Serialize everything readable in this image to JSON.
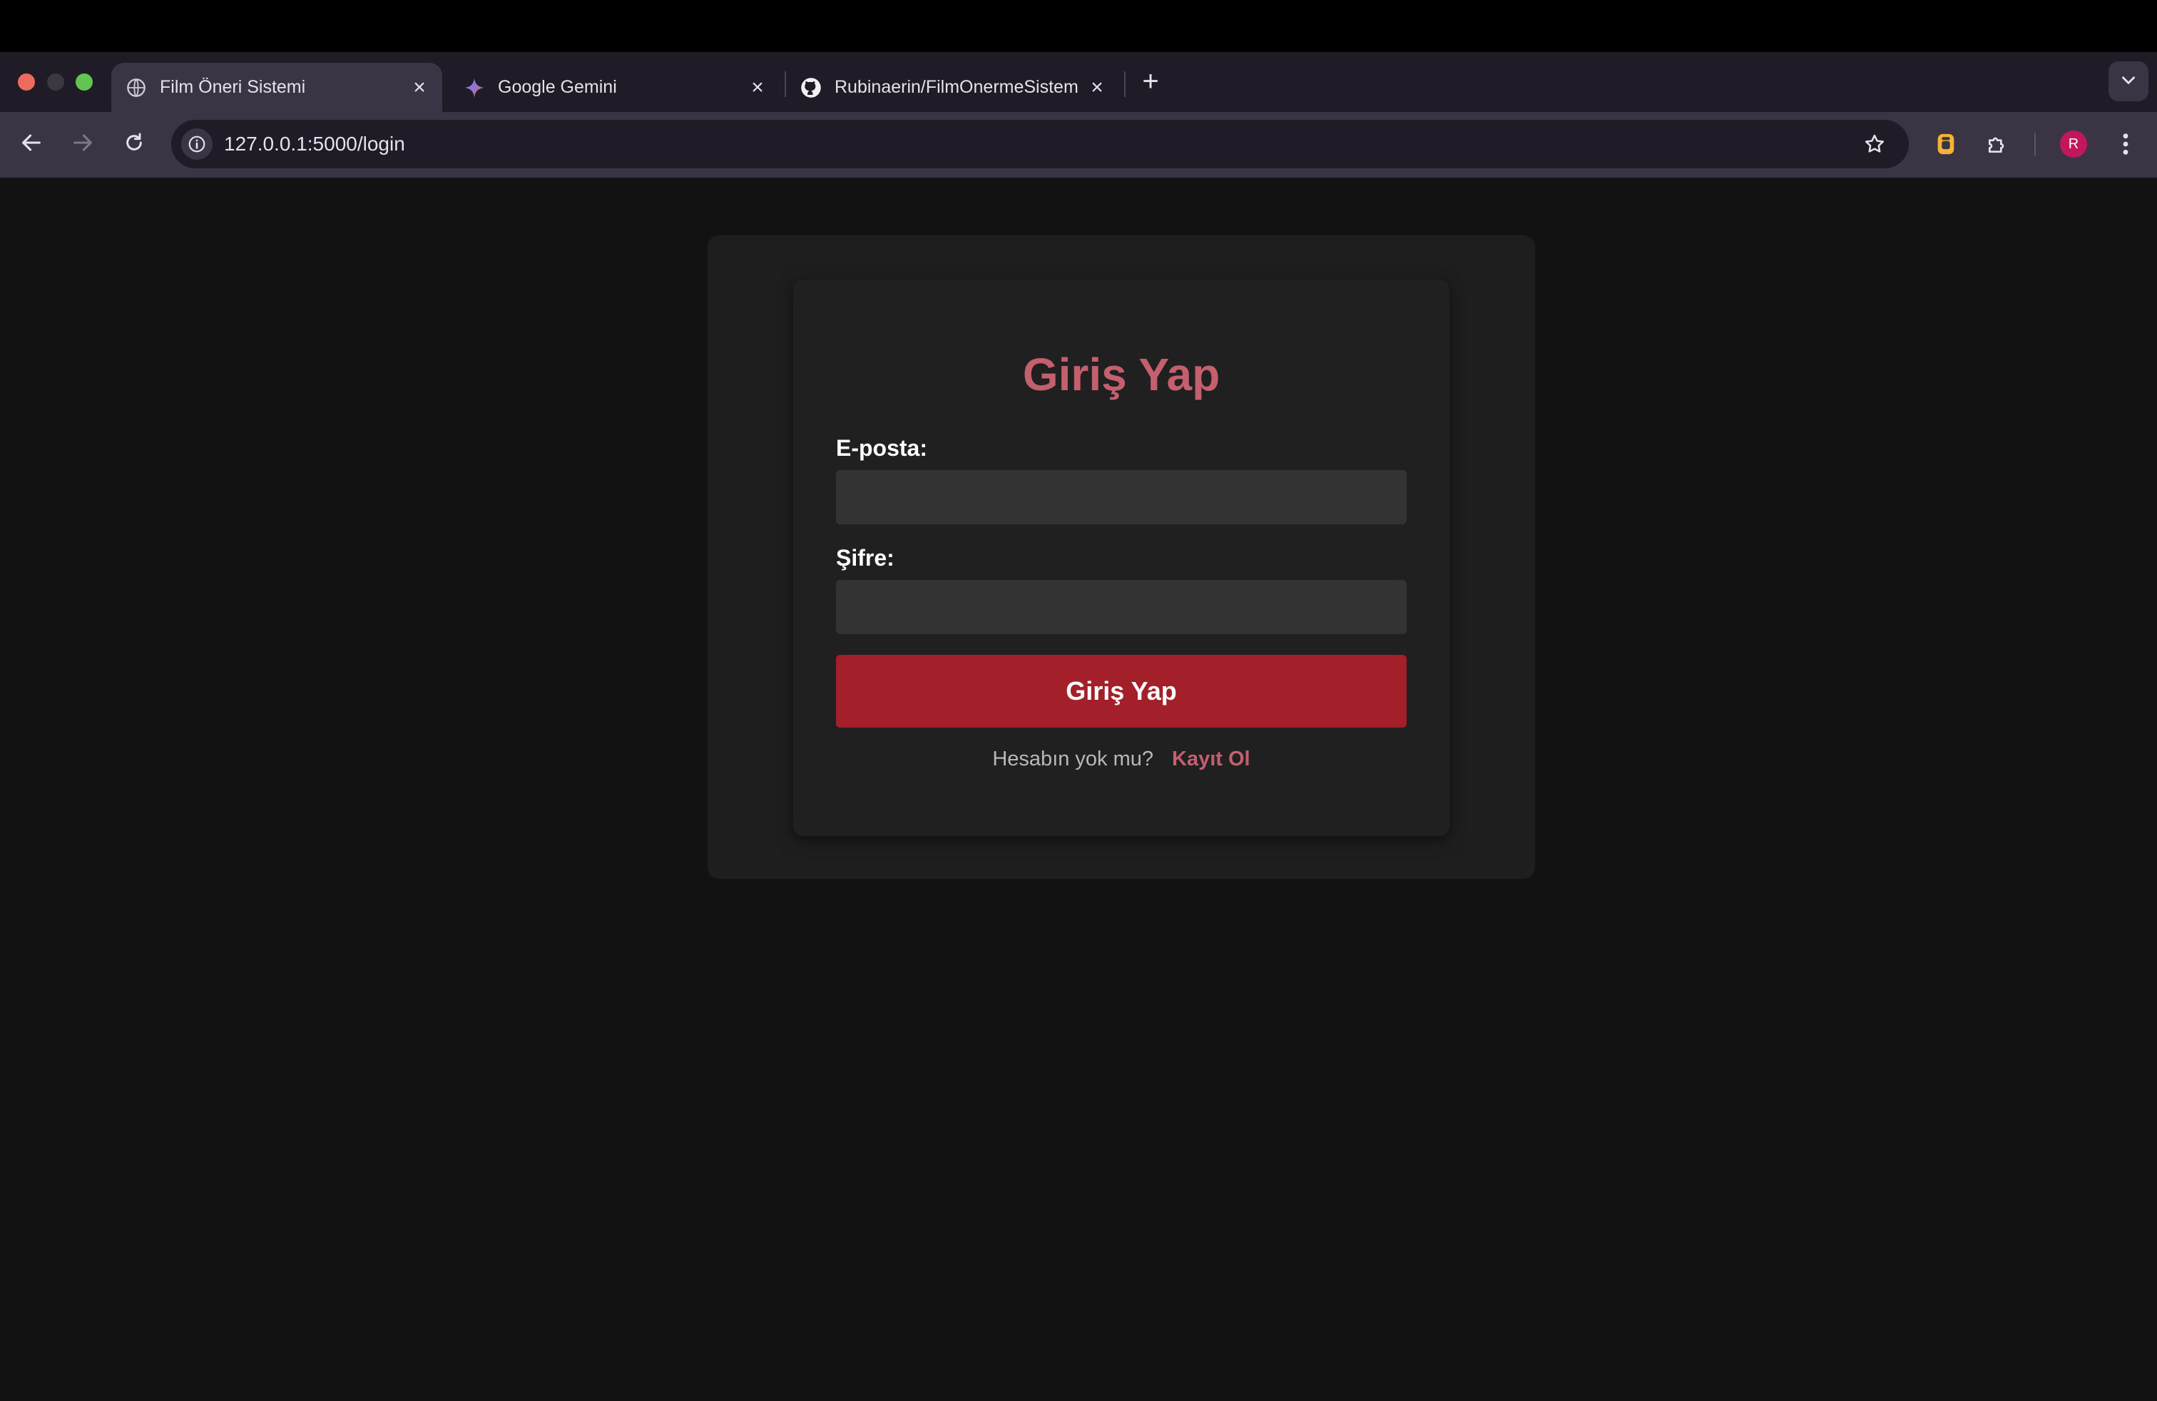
{
  "browser": {
    "tabs": [
      {
        "title": "Film Öneri Sistemi",
        "icon": "globe-icon",
        "active": true
      },
      {
        "title": "Google Gemini",
        "icon": "gemini-icon",
        "active": false
      },
      {
        "title": "Rubinaerin/FilmOnermeSistem",
        "icon": "github-icon",
        "active": false
      }
    ],
    "url": "127.0.0.1:5000/login",
    "profile_initial": "R"
  },
  "login": {
    "heading": "Giriş Yap",
    "email_label": "E-posta:",
    "email_value": "",
    "password_label": "Şifre:",
    "password_value": "",
    "submit_label": "Giriş Yap",
    "no_account_text": "Hesabın yok mu?",
    "register_link": "Kayıt Ol"
  },
  "colors": {
    "accent": "#c45f6e",
    "button": "#a3202b",
    "background": "#121212",
    "card": "#202020"
  }
}
